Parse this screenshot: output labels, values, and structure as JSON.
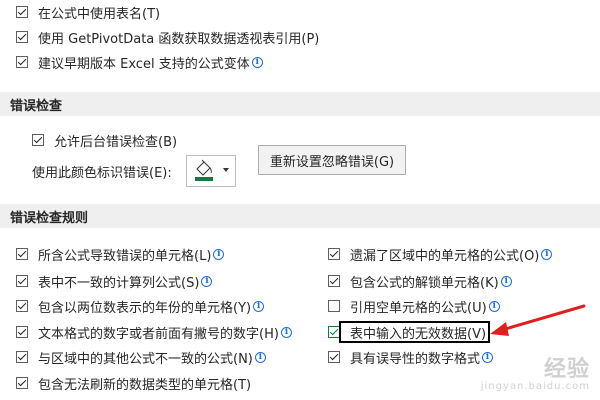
{
  "top_options": [
    {
      "label": "在公式中使用表名(T)",
      "checked": true,
      "info": false
    },
    {
      "label": "使用 GetPivotData 函数获取数据透视表引用(P)",
      "checked": true,
      "info": false
    },
    {
      "label": "建议早期版本 Excel 支持的公式变体",
      "checked": true,
      "info": true
    }
  ],
  "error_checking": {
    "title": "错误检查",
    "enable_background": {
      "label": "允许后台错误检查(B)",
      "checked": true
    },
    "color_label": "使用此颜色标识错误(E):",
    "reset_button": "重新设置忽略错误(G)",
    "colors": {
      "swatch": "#107c41"
    }
  },
  "rules": {
    "title": "错误检查规则",
    "left": [
      {
        "label": "所含公式导致错误的单元格(L)",
        "checked": true
      },
      {
        "label": "表中不一致的计算列公式(S)",
        "checked": true
      },
      {
        "label": "包含以两位数表示的年份的单元格(Y)",
        "checked": true
      },
      {
        "label": "文本格式的数字或者前面有撇号的数字(H)",
        "checked": true
      },
      {
        "label": "与区域中的其他公式不一致的公式(N)",
        "checked": true
      },
      {
        "label": "包含无法刷新的数据类型的单元格(T)",
        "checked": true
      }
    ],
    "right": [
      {
        "label": "遗漏了区域中的单元格的公式(O)",
        "checked": true
      },
      {
        "label": "包含公式的解锁单元格(K)",
        "checked": true
      },
      {
        "label": "引用空单元格的公式(U)",
        "checked": false
      },
      {
        "label": "表中输入的无效数据(V)",
        "checked": true
      },
      {
        "label": "具有误导性的数字格式",
        "checked": true
      }
    ]
  },
  "annotation": {
    "arrow_color": "#e02020"
  },
  "info_glyph": "i",
  "watermark": {
    "main": "经验",
    "sub": "jingyan.baidu.com"
  }
}
